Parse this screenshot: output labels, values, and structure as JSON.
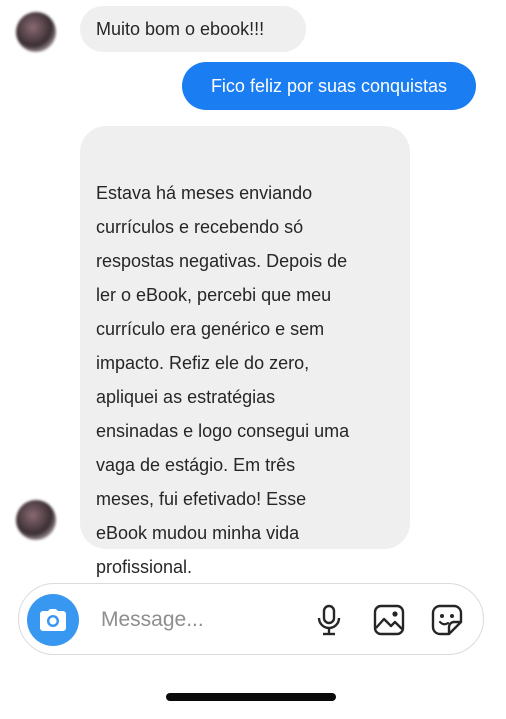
{
  "messages": [
    {
      "direction": "incoming",
      "text": "Muito bom o ebook!!!"
    },
    {
      "direction": "outgoing",
      "text": "Fico feliz por suas conquistas"
    },
    {
      "direction": "incoming",
      "text": "Estava há meses enviando\ncurrículos e recebendo só\nrespostas negativas. Depois de\nler o eBook, percebi que meu\ncurrículo era genérico e sem\nimpacto. Refiz ele do zero,\napliquei as estratégias\nensinadas e logo consegui uma\nvaga de estágio. Em três\nmeses, fui efetivado! Esse\neBook mudou minha vida\nprofissional."
    }
  ],
  "composer": {
    "placeholder": "Message...",
    "icons": [
      "camera-icon",
      "microphone-icon",
      "gallery-icon",
      "sticker-icon"
    ]
  },
  "colors": {
    "outgoing_bubble": "#1b7df2",
    "incoming_bubble": "#efefef",
    "camera_button": "#3897f0"
  }
}
